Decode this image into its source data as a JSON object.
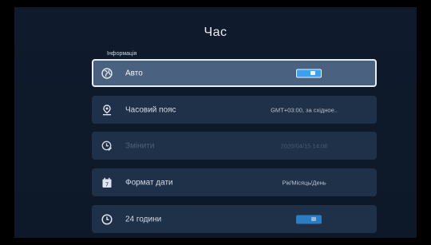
{
  "header": {
    "title": "Час"
  },
  "section": {
    "label": "Інформація"
  },
  "items": [
    {
      "label": "Авто",
      "value": "",
      "toggle": true,
      "selected": true,
      "disabled": false,
      "icon": "globe-icon"
    },
    {
      "label": "Часовий пояс",
      "value": "GMT+03:00, за східное..",
      "toggle": false,
      "selected": false,
      "disabled": false,
      "icon": "location-pin-icon"
    },
    {
      "label": "Змінити",
      "value": "2020/04/15 14:08",
      "toggle": false,
      "selected": false,
      "disabled": true,
      "icon": "clock-edit-icon"
    },
    {
      "label": "Формат дати",
      "value": "Рік/Місяць/День",
      "toggle": false,
      "selected": false,
      "disabled": false,
      "icon": "calendar-icon"
    },
    {
      "label": "24 години",
      "value": "",
      "toggle": true,
      "selected": false,
      "disabled": false,
      "icon": "clock-icon"
    }
  ],
  "colors": {
    "background": "#0e1a2b",
    "row": "#1f3049",
    "row_selected": "#4a6180",
    "toggle_on": "#2d8fe0"
  }
}
